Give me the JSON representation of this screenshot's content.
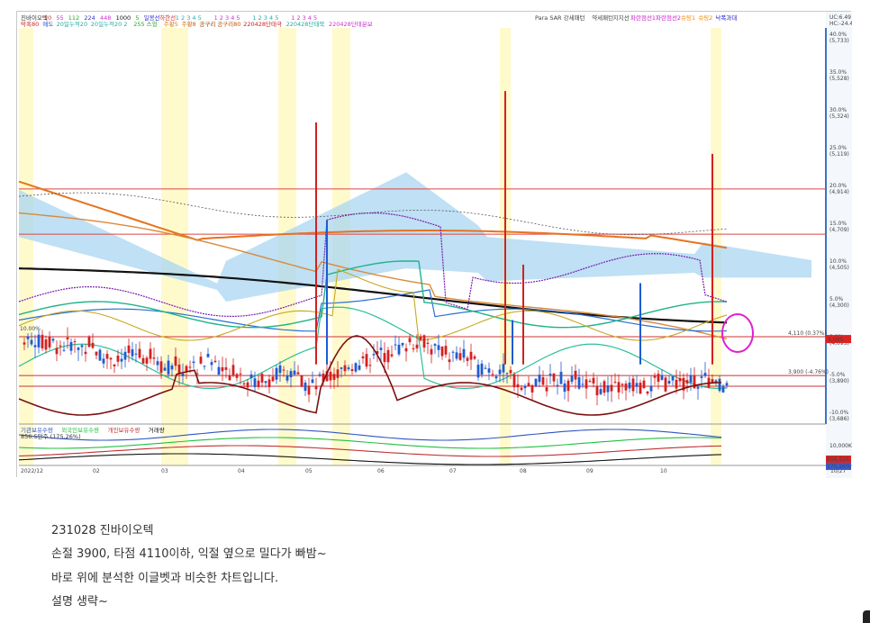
{
  "chart_data": {
    "type": "candlestick",
    "legend_top_line1": [
      "진바이오텍",
      "20",
      "55",
      "112",
      "224",
      "448",
      "1000",
      "5",
      "일봉선",
      "하한선",
      "1 2 3 4 5",
      "1 2 3 4 5",
      "1 2 3 4 5",
      "1 2 3 4 5"
    ],
    "legend_top_line2": [
      "막혹80",
      "매도",
      "20일누적20",
      "20일누적20 2",
      "255 스윙",
      "주황5",
      "주황8",
      "공구리",
      "공구리80",
      "220428단태극",
      "220428단태북",
      "220428단태분보"
    ],
    "legend_top_right": [
      "Para SAR 강세패턴",
      "약세패턴",
      "지지선",
      "파란점선1",
      "파란점선2",
      "슈팅1",
      "슈팅2",
      "낙폭과대"
    ],
    "corner_right": [
      "UC:6.49",
      "HC:-24.40"
    ],
    "y_axis_labels": [
      {
        "label": "40.0%",
        "sub": "(5,733)",
        "pct": 40.0
      },
      {
        "label": "35.0%",
        "sub": "(5,528)",
        "pct": 35.0
      },
      {
        "label": "30.0%",
        "sub": "(5,324)",
        "pct": 30.0
      },
      {
        "label": "25.0%",
        "sub": "(5,119)",
        "pct": 25.0
      },
      {
        "label": "20.0%",
        "sub": "(4,914)",
        "pct": 20.0
      },
      {
        "label": "15.0%",
        "sub": "(4,709)",
        "pct": 15.0
      },
      {
        "label": "10.0%",
        "sub": "(4,505)",
        "pct": 10.0
      },
      {
        "label": "5.0%",
        "sub": "(4,300)",
        "pct": 5.0
      },
      {
        "label": "0.0%",
        "sub": "(4,095)",
        "pct": 0.0
      },
      {
        "label": "-5.0%",
        "sub": "(3,890)",
        "pct": -5.0
      },
      {
        "label": "-10.0%",
        "sub": "(3,686)",
        "pct": -10.0
      }
    ],
    "price_annotations": [
      {
        "label": "4,110 (0.37%)",
        "price": 4110
      },
      {
        "label": "3,900 (-4.76%)",
        "price": 3900
      }
    ],
    "current_price_tag": "4,095",
    "x_axis_labels": [
      "2022/12",
      "02",
      "03",
      "04",
      "05",
      "06",
      "07",
      "08",
      "09",
      "10",
      "10/27"
    ],
    "left_axis_label": "10.00%",
    "sub_legend": [
      "기관보유수량",
      "외국인보유수량",
      "개인보유수량",
      "거래량"
    ],
    "sub_legend_2": "856.5만주 (175.26%)",
    "sub_axis_label": "10,000K",
    "sub_axis_tags": [
      "856,526",
      "175.26%"
    ],
    "colors": {
      "up": "#d42020",
      "down": "#1f5bd1",
      "ichimoku_cloud": "#a9d6f2",
      "ma_black": "#111111",
      "ma_orange": "#e6731f",
      "ma_purple": "#7b1fb0",
      "ma_teal": "#20b38a",
      "oscillator": "#7a1010",
      "highlight_band": "#fffacc",
      "circle": "#e020d0"
    }
  },
  "caption": {
    "line1": "231028 진바이오텍",
    "line2": "손절 3900, 타점 4110이하, 익절 옆으로 밀다가 빠밤~",
    "line3": "바로 위에 분석한 이글벳과 비슷한 차트입니다.",
    "line4": "설명 생략~"
  }
}
